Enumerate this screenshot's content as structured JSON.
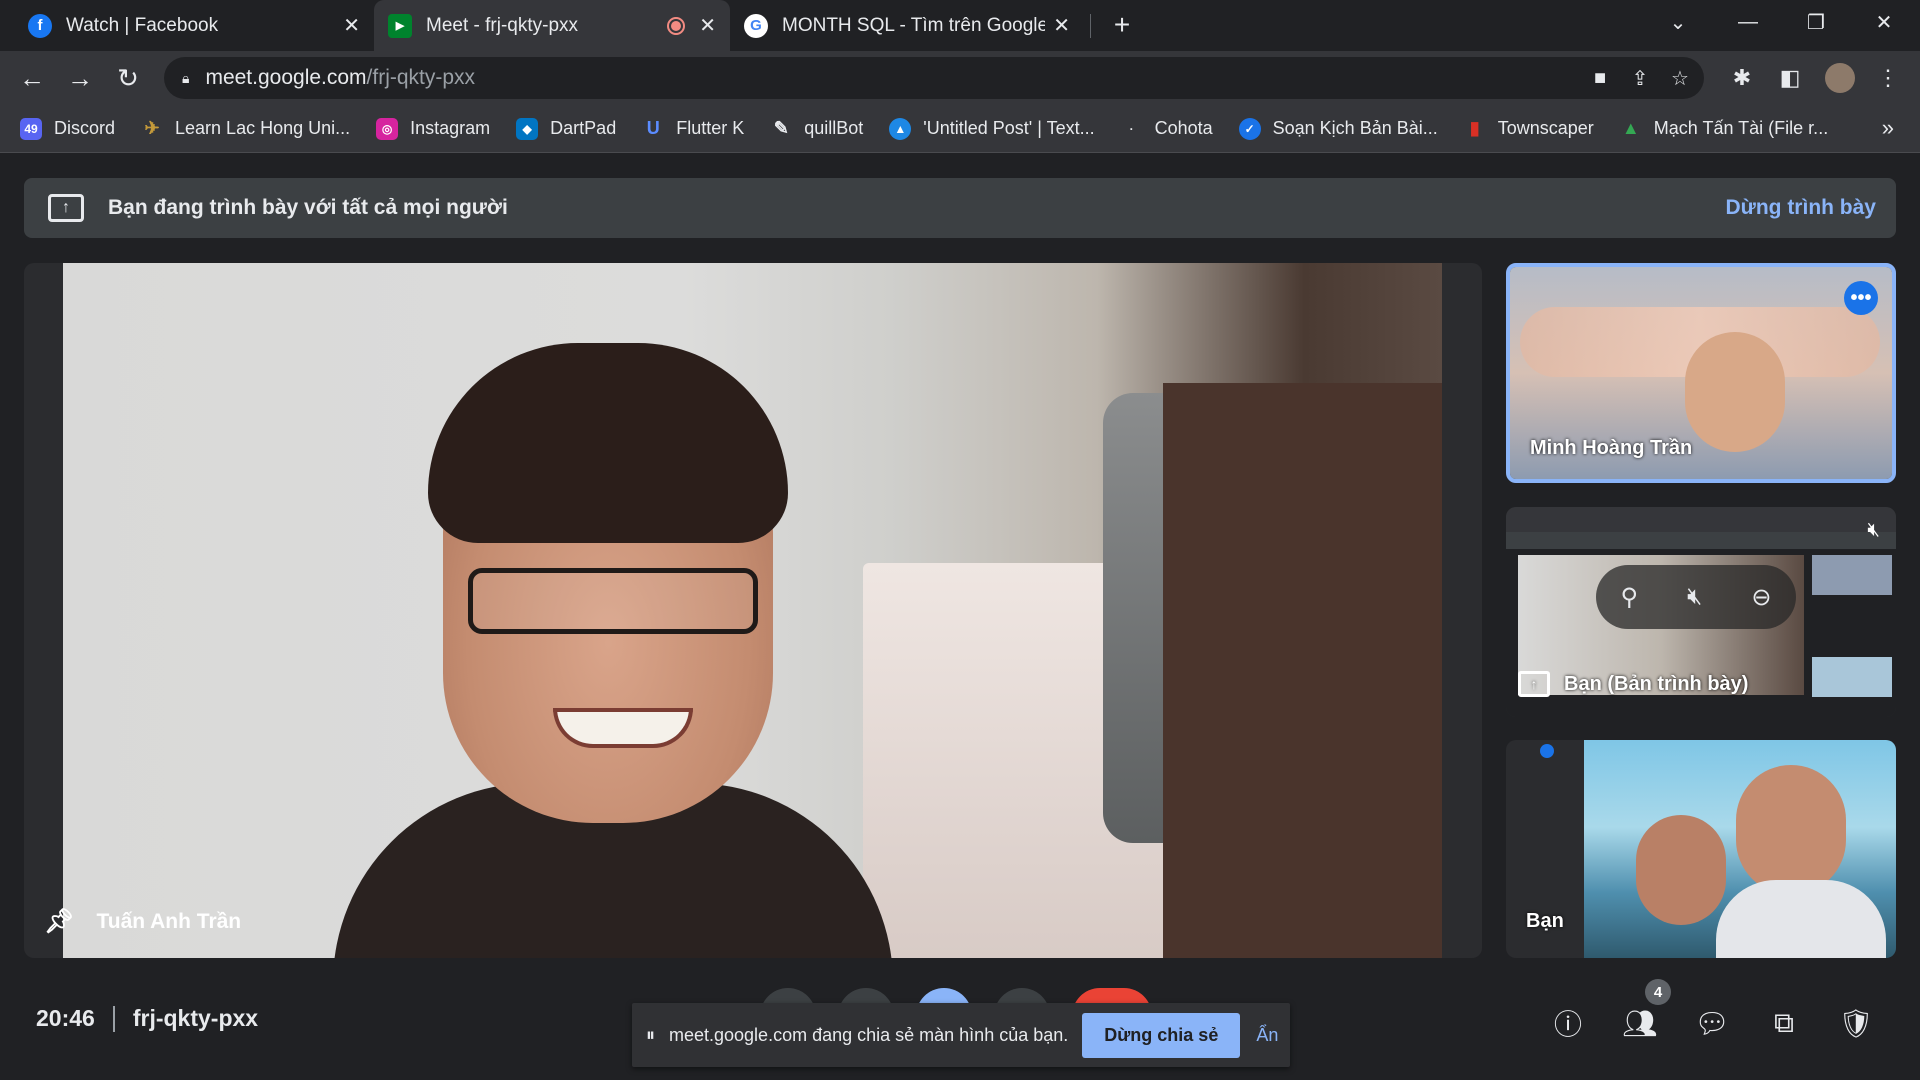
{
  "browser": {
    "tabs": [
      {
        "title": "Watch | Facebook",
        "icon": "facebook-icon",
        "color": "#1877f2",
        "glyph": "f"
      },
      {
        "title": "Meet - frj-qkty-pxx",
        "icon": "google-meet-icon",
        "color": "#00832d",
        "glyph": "▶"
      },
      {
        "title": "MONTH SQL - Tìm trên Google",
        "icon": "google-icon",
        "color": "#ffffff",
        "glyph": "G"
      }
    ],
    "new_tab": "+",
    "url_host": "meet.google.com",
    "url_path": "/frj-qkty-pxx",
    "bookmarks": [
      {
        "label": "Discord",
        "color": "#5865f2",
        "glyph": "49"
      },
      {
        "label": "Learn Lac Hong Uni...",
        "color": "#c49a3a",
        "glyph": "✈"
      },
      {
        "label": "Instagram",
        "color": "#d6249f",
        "glyph": "◎"
      },
      {
        "label": "DartPad",
        "color": "#0175c2",
        "glyph": "◆"
      },
      {
        "label": "Flutter K",
        "color": "#3b6cff",
        "glyph": "U"
      },
      {
        "label": "quillBot",
        "color": "#35363a",
        "glyph": "✎"
      },
      {
        "label": "'Untitled Post' | Text...",
        "color": "#1e88e5",
        "glyph": "▲"
      },
      {
        "label": "Cohota",
        "color": "#35363a",
        "glyph": "·"
      },
      {
        "label": "Soạn Kịch Bản Bài...",
        "color": "#1a73e8",
        "glyph": "✓"
      },
      {
        "label": "Townscaper",
        "color": "#d93025",
        "glyph": "▮"
      },
      {
        "label": "Mạch Tấn Tài (File r...",
        "color": "#34a853",
        "glyph": "▲"
      }
    ],
    "bookmarks_more": "»"
  },
  "meet": {
    "present_banner_text": "Bạn đang trình bày với tất cả mọi người",
    "present_stop": "Dừng trình bày",
    "main_participant": "Tuấn Anh Trần",
    "side_tiles": [
      {
        "name": "Minh Hoàng Trần"
      },
      {
        "name": "Bạn (Bản trình bày)"
      },
      {
        "name": "Bạn"
      }
    ],
    "time": "20:46",
    "meeting_code": "frj-qkty-pxx",
    "participant_count": "4",
    "share_notice": "meet.google.com đang chia sẻ màn hình của bạn.",
    "share_stop": "Dừng chia sẻ",
    "share_hide": "Ẩn"
  },
  "colors": {
    "accent": "#8ab4f8",
    "active_border": "#8ab4f8",
    "more_button": "#1a73e8"
  }
}
